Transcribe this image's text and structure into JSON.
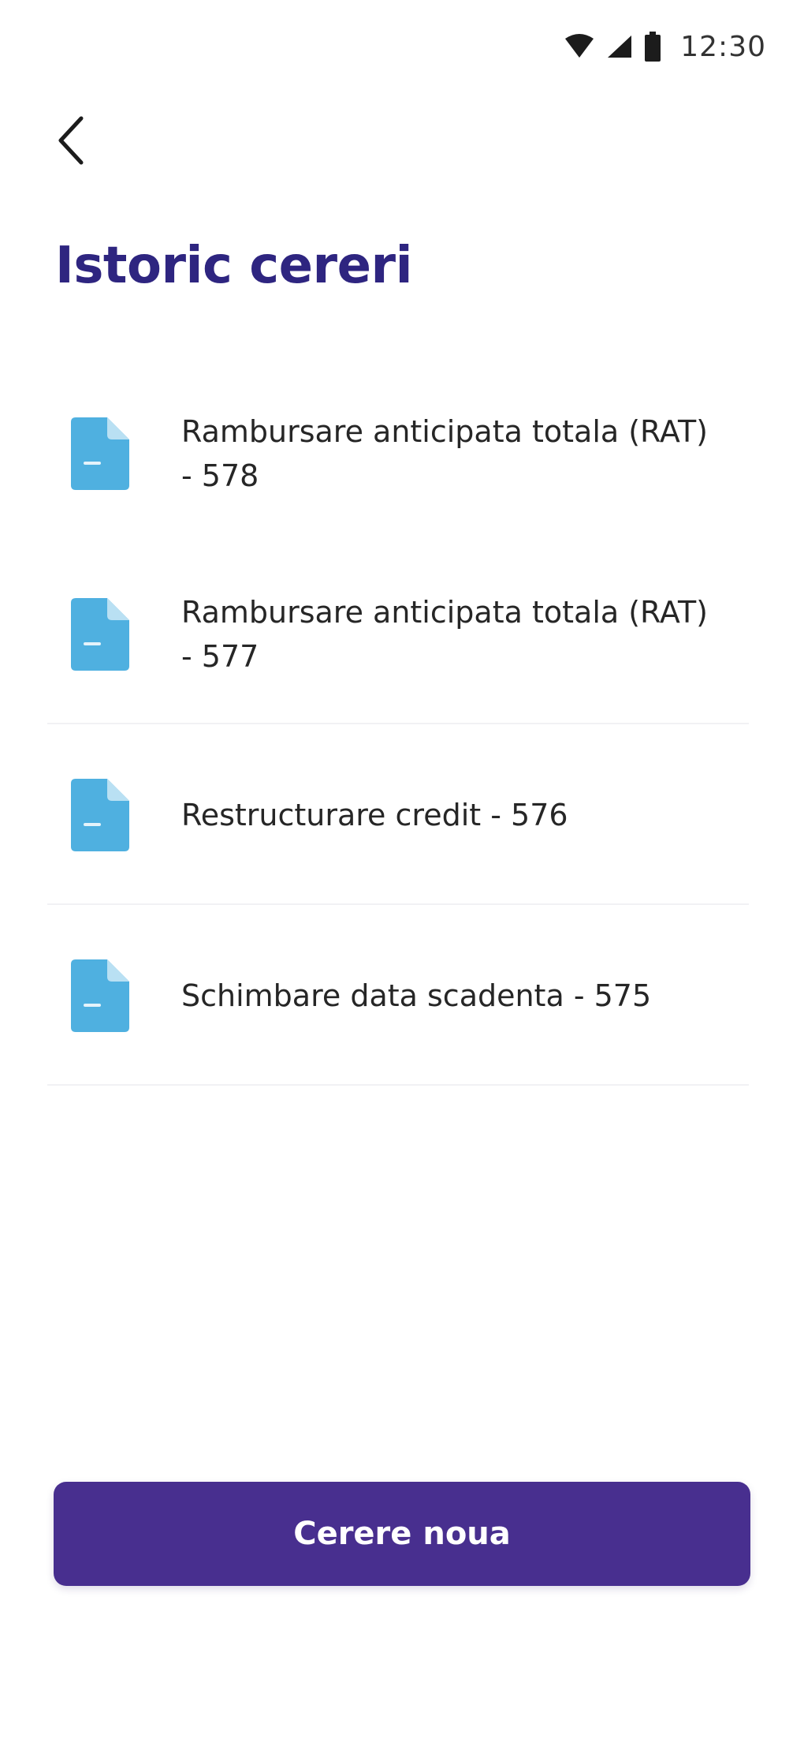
{
  "status_bar": {
    "time": "12:30",
    "icons": [
      "wifi-icon",
      "signal-icon",
      "battery-icon"
    ]
  },
  "header": {
    "back_icon": "chevron-left-icon",
    "title": "Istoric cereri"
  },
  "requests": [
    {
      "label": "Rambursare anticipata totala (RAT) - 578",
      "icon": "document-icon"
    },
    {
      "label": "Rambursare anticipata totala (RAT) - 577",
      "icon": "document-icon"
    },
    {
      "label": "Restructurare credit - 576",
      "icon": "document-icon"
    },
    {
      "label": "Schimbare data scadenta - 575",
      "icon": "document-icon"
    }
  ],
  "footer": {
    "new_request_label": "Cerere noua"
  },
  "colors": {
    "title": "#2e2580",
    "primary_button": "#482f8f",
    "document_icon": "#4fb0e0",
    "divider": "#f1f1f4"
  }
}
